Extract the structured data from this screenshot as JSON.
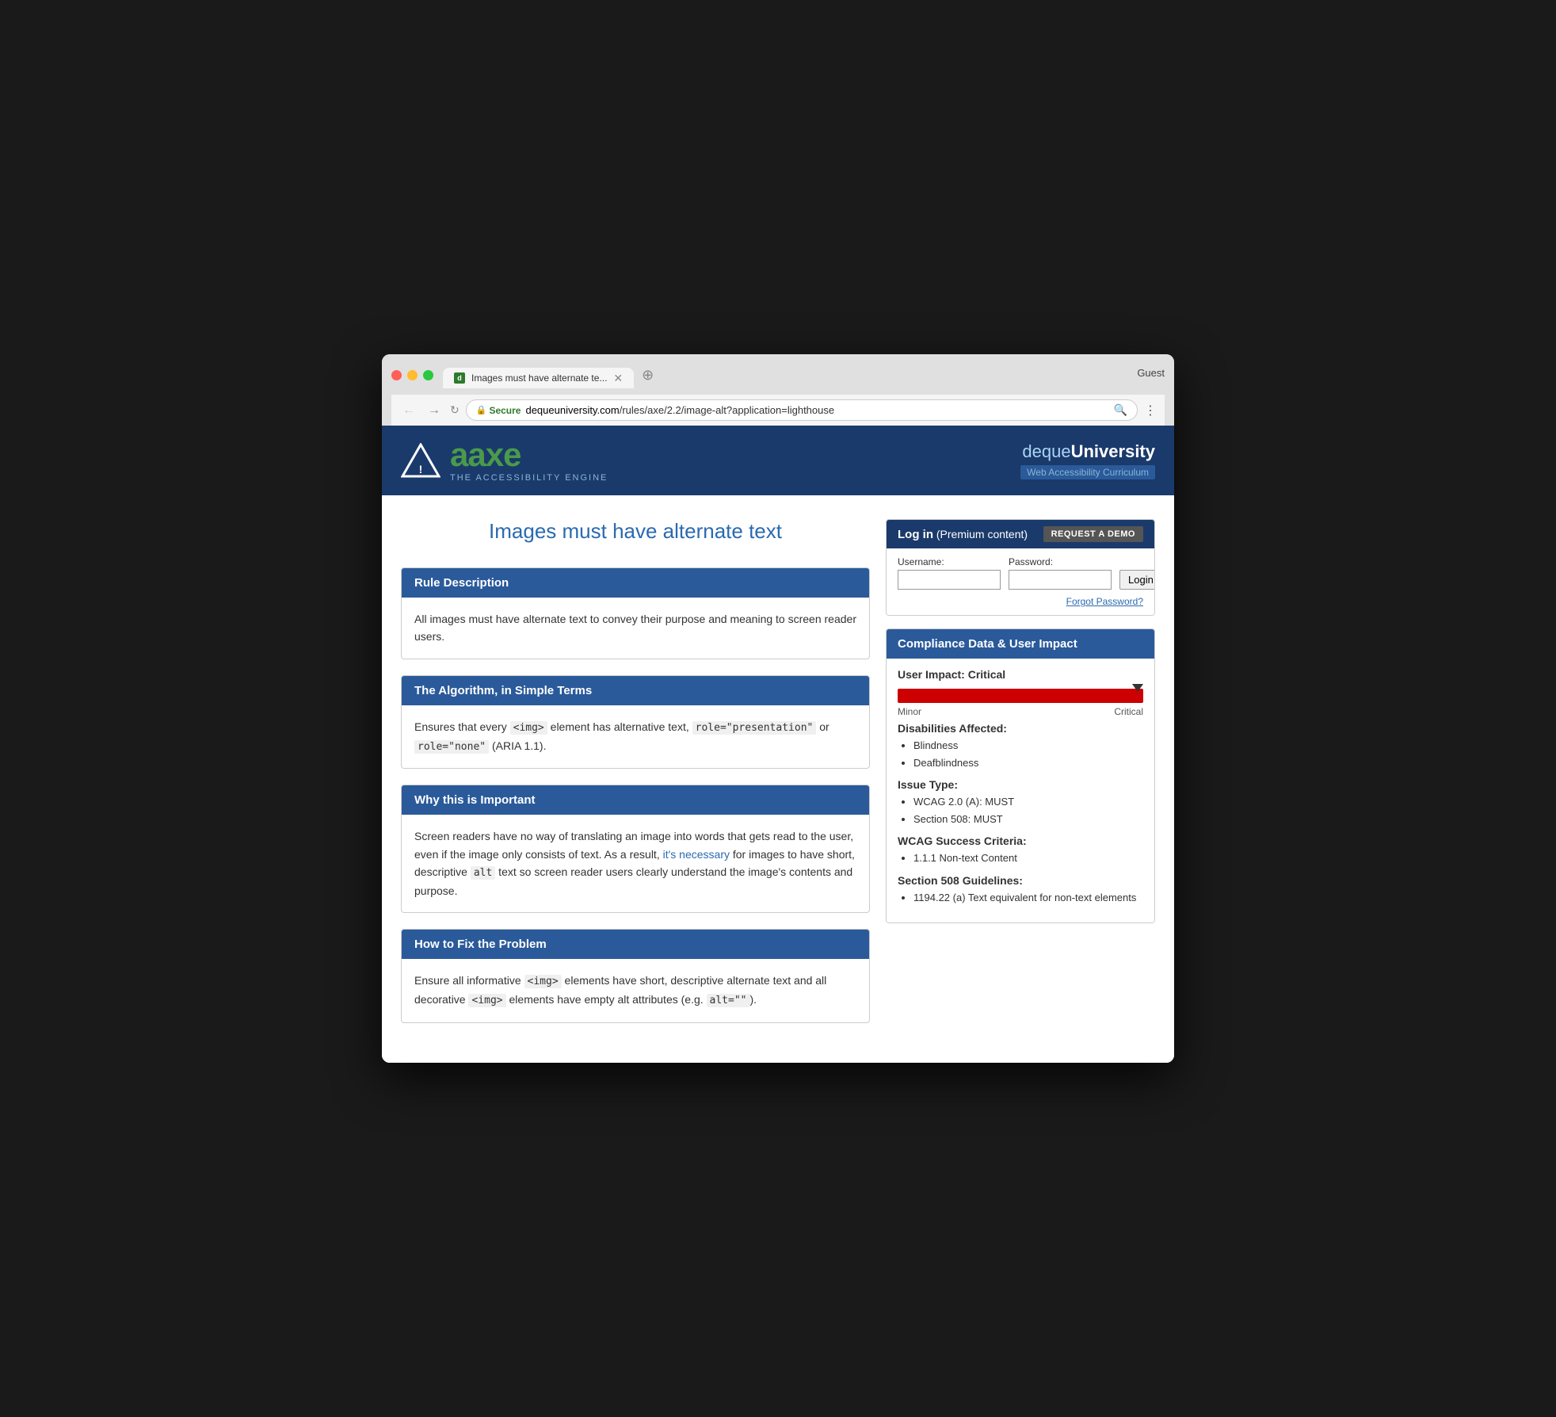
{
  "browser": {
    "tab_title": "Images must have alternate te...",
    "tab_favicon": "d",
    "guest_label": "Guest",
    "url_secure": "Secure",
    "url_full": "https://dequeuniversity.com/rules/axe/2.2/image-alt?application=lighthouse",
    "url_domain": "dequeuniversity.com",
    "url_path": "/rules/axe/2.2/image-alt?application=lighthouse"
  },
  "header": {
    "axe_name": "axe",
    "axe_tagline": "THE ACCESSIBILITY ENGINE",
    "deque_name": "dequeUniversity",
    "deque_subtitle": "Web Accessibility Curriculum"
  },
  "page": {
    "title": "Images must have alternate text"
  },
  "login": {
    "header_text": "Log in",
    "header_subtext": "(Premium content)",
    "request_demo_label": "REQUEST A DEMO",
    "username_label": "Username:",
    "password_label": "Password:",
    "login_button_label": "Login",
    "forgot_password_label": "Forgot Password?"
  },
  "sections": {
    "rule_description": {
      "title": "Rule Description",
      "body": "All images must have alternate text to convey their purpose and meaning to screen reader users."
    },
    "algorithm": {
      "title": "The Algorithm, in Simple Terms",
      "body_prefix": "Ensures that every ",
      "code1": "<img>",
      "body_middle": " element has alternative text, ",
      "code2": "role=\"presentation\"",
      "body_middle2": " or ",
      "code3": "role=\"none\"",
      "body_suffix": " (ARIA 1.1)."
    },
    "importance": {
      "title": "Why this is Important",
      "body": "Screen readers have no way of translating an image into words that gets read to the user, even if the image only consists of text. As a result, it's necessary for images to have short, descriptive alt text so screen reader users clearly understand the image's contents and purpose."
    },
    "fix": {
      "title": "How to Fix the Problem",
      "body_prefix": "Ensure all informative ",
      "code1": "<img>",
      "body_middle": " elements have short, descriptive alternate text and all decorative ",
      "code2": "<img>",
      "body_suffix_prefix": " elements have empty alt attributes (e.g. ",
      "code3": "alt=\"\"",
      "body_suffix": ")."
    }
  },
  "compliance": {
    "header": "Compliance Data & User Impact",
    "user_impact_label": "User Impact:",
    "user_impact_value": "Critical",
    "impact_min_label": "Minor",
    "impact_max_label": "Critical",
    "disabilities_title": "Disabilities Affected:",
    "disabilities": [
      "Blindness",
      "Deafblindness"
    ],
    "issue_type_title": "Issue Type:",
    "issue_types": [
      "WCAG 2.0 (A): MUST",
      "Section 508: MUST"
    ],
    "wcag_title": "WCAG Success Criteria:",
    "wcag_items": [
      "1.1.1 Non-text Content"
    ],
    "section508_title": "Section 508 Guidelines:",
    "section508_items": [
      "1194.22 (a) Text equivalent for non-text elements"
    ]
  }
}
